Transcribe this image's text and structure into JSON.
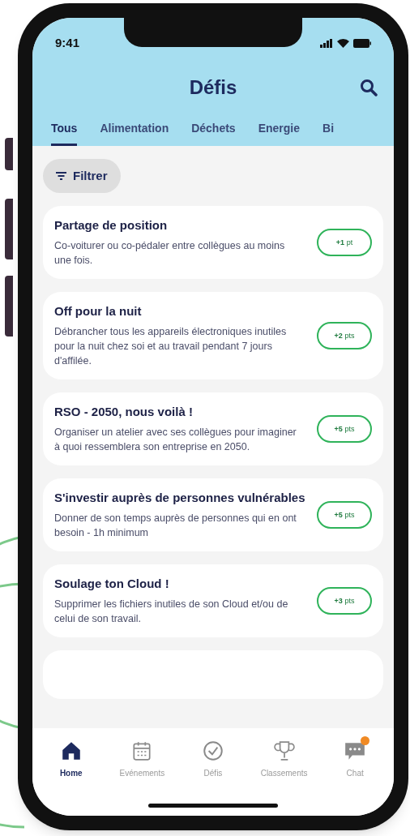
{
  "status_bar": {
    "time": "9:41"
  },
  "header": {
    "title": "Défis"
  },
  "tabs": [
    {
      "label": "Tous",
      "selected": true
    },
    {
      "label": "Alimentation",
      "selected": false
    },
    {
      "label": "Déchets",
      "selected": false
    },
    {
      "label": "Energie",
      "selected": false
    },
    {
      "label": "Bi",
      "selected": false
    }
  ],
  "filter_button": "Filtrer",
  "challenges": [
    {
      "title": "Partage de position",
      "description": "Co-voiturer ou co-pédaler entre collègues au moins une fois.",
      "points": "**+1** pt"
    },
    {
      "title": "Off pour la nuit",
      "description": "Débrancher tous les appareils électroniques inutiles pour la nuit chez soi et au travail pendant 7 jours d'affilée.",
      "points": "**+2** pts"
    },
    {
      "title": "RSO - 2050, nous voilà !",
      "description": "Organiser un atelier avec ses collègues pour imaginer à quoi ressemblera son entreprise en 2050.",
      "points": "**+5** pts"
    },
    {
      "title": "S'investir auprès de personnes vulnérables",
      "description": "Donner de son temps auprès de personnes qui en ont besoin - 1h minimum",
      "points": "**+5** pts"
    },
    {
      "title": "Soulage ton Cloud !",
      "description": "Supprimer les fichiers inutiles de son Cloud et/ou de celui de son travail.",
      "points": "**+3** pts"
    }
  ],
  "bottom_nav": [
    {
      "kind": "home",
      "label": "Home",
      "selected": true,
      "badge": false
    },
    {
      "kind": "calendar",
      "label": "Evénements",
      "selected": false,
      "badge": false
    },
    {
      "kind": "check",
      "label": "Défis",
      "selected": false,
      "badge": false
    },
    {
      "kind": "trophy",
      "label": "Classements",
      "selected": false,
      "badge": false
    },
    {
      "kind": "chat",
      "label": "Chat",
      "selected": false,
      "badge": true
    }
  ]
}
